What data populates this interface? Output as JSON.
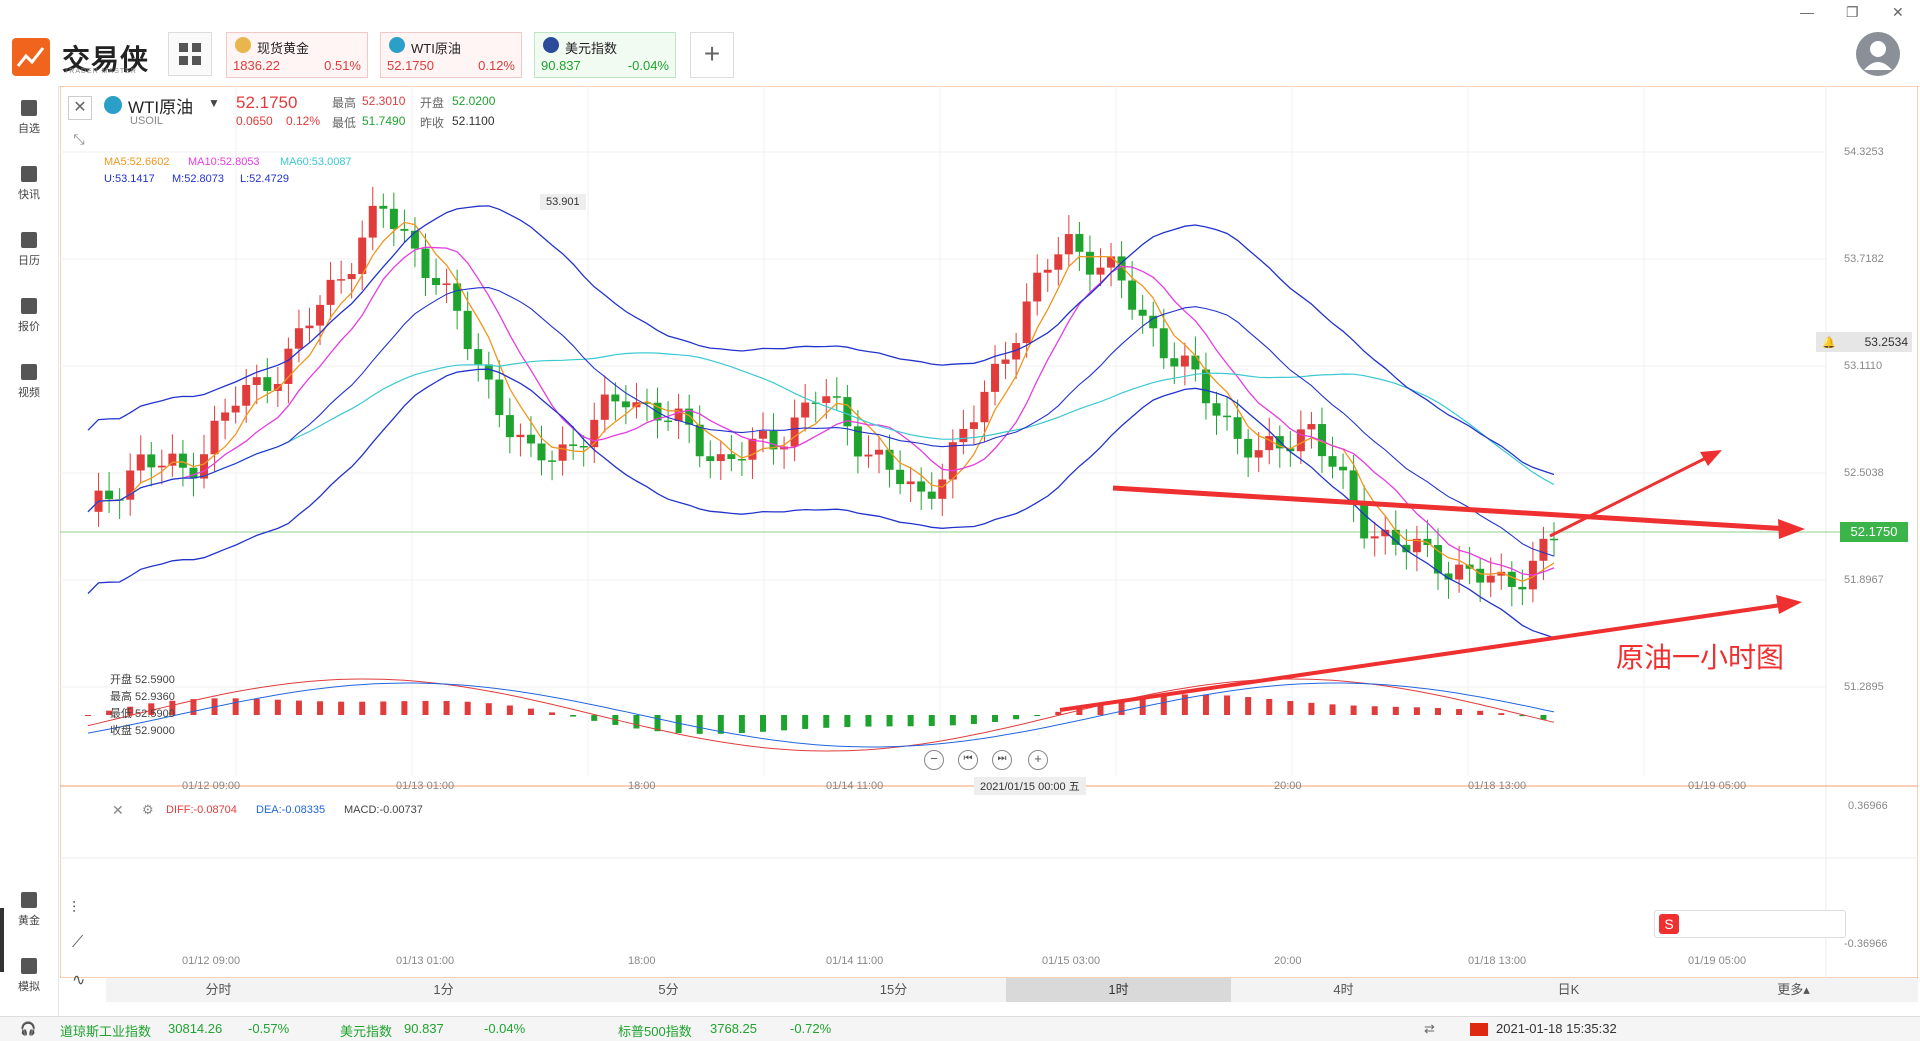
{
  "app": {
    "logo_text": "交易侠",
    "logo_sub": "TRADER MASTER"
  },
  "quotes": [
    {
      "name": "现货黄金",
      "price": "1836.22",
      "change": "0.51%",
      "dir": "up"
    },
    {
      "name": "WTI原油",
      "price": "52.1750",
      "change": "0.12%",
      "dir": "up"
    },
    {
      "name": "美元指数",
      "price": "90.837",
      "change": "-0.04%",
      "dir": "down"
    }
  ],
  "sidebar": {
    "items": [
      {
        "label": "自选"
      },
      {
        "label": "快讯"
      },
      {
        "label": "日历"
      },
      {
        "label": "报价"
      },
      {
        "label": "视频"
      }
    ],
    "bottom": [
      {
        "label": "黄金"
      },
      {
        "label": "模拟"
      }
    ]
  },
  "instrument": {
    "name": "WTI原油",
    "code": "USOIL",
    "price": "52.1750",
    "change": "0.0650",
    "change_pct": "0.12%",
    "high_label": "最高",
    "high": "52.3010",
    "low_label": "最低",
    "low": "51.7490",
    "open_label": "开盘",
    "open": "52.0200",
    "prev_label": "昨收",
    "prev": "52.1100"
  },
  "ma": {
    "ma5": "MA5:52.6602",
    "ma10": "MA10:52.8053",
    "ma60": "MA60:53.0087"
  },
  "boll": {
    "u": "U:53.1417",
    "m": "M:52.8073",
    "l": "L:52.4729"
  },
  "tooltip_ohlc": [
    "开盘 52.5900",
    "最高 52.9360",
    "最低 52.5900",
    "收盘 52.9000"
  ],
  "peak_label": "53.901",
  "price_axis": [
    "54.3253",
    "53.7182",
    "53.2534",
    "53.1110",
    "52.5038",
    "52.1750",
    "51.8967",
    "51.2895"
  ],
  "time_axis": [
    "01/12 09:00",
    "01/13 01:00",
    "18:00",
    "01/14 11:00",
    "2021/01/15 00:00 五",
    "20:00",
    "01/18 13:00",
    "01/19 05:00"
  ],
  "macd": {
    "diff": "DIFF:-0.08704",
    "dea": "DEA:-0.08335",
    "macd": "MACD:-0.00737",
    "axis_top": "0.36966",
    "axis_bottom": "-0.36966"
  },
  "macd_time_axis": [
    "01/12 09:00",
    "01/13 01:00",
    "18:00",
    "01/14 11:00",
    "01/15 03:00",
    "20:00",
    "01/18 13:00",
    "01/19 05:00"
  ],
  "annotation": "原油一小时图",
  "timeframes": [
    "分时",
    "1分",
    "5分",
    "15分",
    "1时",
    "4时",
    "日K",
    "更多▴"
  ],
  "active_timeframe": "1时",
  "status": {
    "dow_name": "道琼斯工业指数",
    "dow_val": "30814.26",
    "dow_pct": "-0.57%",
    "usd_name": "美元指数",
    "usd_val": "90.837",
    "usd_pct": "-0.04%",
    "sp_name": "标普500指数",
    "sp_val": "3768.25",
    "sp_pct": "-0.72%",
    "datetime": "2021-01-18 15:35:32"
  },
  "colors": {
    "up": "#e03c3c",
    "down": "#1fa32f",
    "boll": "#2233cc",
    "ma5": "#f0961e",
    "ma10": "#e63ce0",
    "ma60": "#3cc8d2",
    "accent": "#f0641e"
  },
  "chart_data": {
    "type": "candlestick",
    "unit_note": "",
    "candles_approx_close": [
      52.3,
      52.6,
      52.55,
      52.9,
      53.1,
      53.5,
      53.9,
      53.6,
      53.1,
      52.6,
      52.7,
      52.95,
      52.8,
      52.6,
      52.7,
      52.95,
      52.65,
      52.4,
      52.75,
      53.3,
      53.75,
      53.55,
      53.2,
      52.9,
      52.6,
      52.8,
      52.3,
      52.15,
      52.05,
      51.95,
      52.2
    ],
    "ylim": [
      51.2895,
      54.3253
    ]
  }
}
